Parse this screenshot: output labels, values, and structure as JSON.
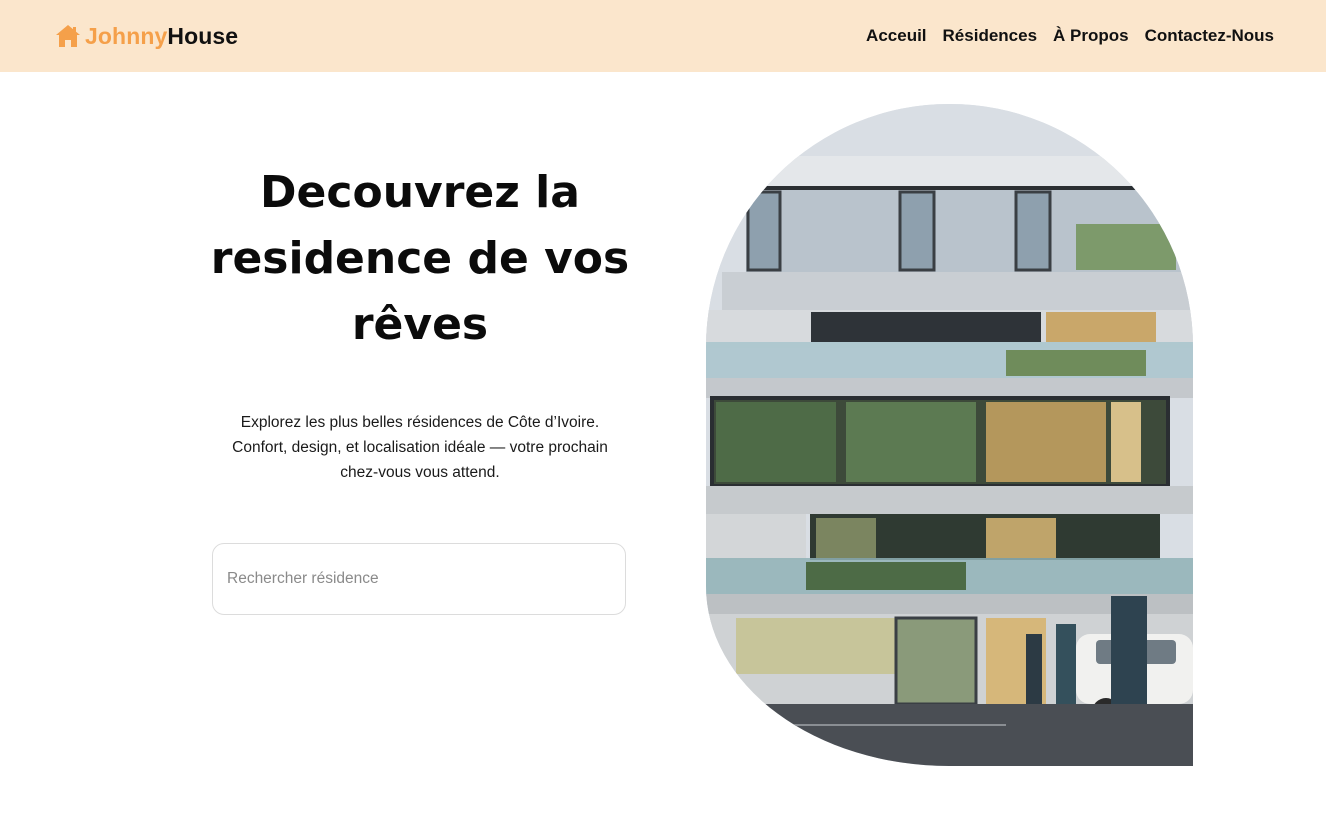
{
  "nav": {
    "logo": {
      "icon": "house-icon",
      "part1": "Johnny",
      "part2": "House",
      "accent": "#f5a04a"
    },
    "links": [
      "Acceuil",
      "Résidences",
      "À Propos",
      "Contactez-Nous"
    ],
    "background": "#fbe6cc"
  },
  "hero": {
    "title_lines": [
      "Decouvrez la",
      "residence de vos",
      "rêves"
    ],
    "description_lines": [
      "Explorez les plus belles résidences de Côte d’Ivoire.",
      "Confort, design, et localisation idéale — votre prochain",
      "chez-vous vous attend."
    ],
    "search": {
      "placeholder": "Rechercher résidence",
      "value": ""
    },
    "image": {
      "subject": "modern-residence-building-photo"
    }
  }
}
